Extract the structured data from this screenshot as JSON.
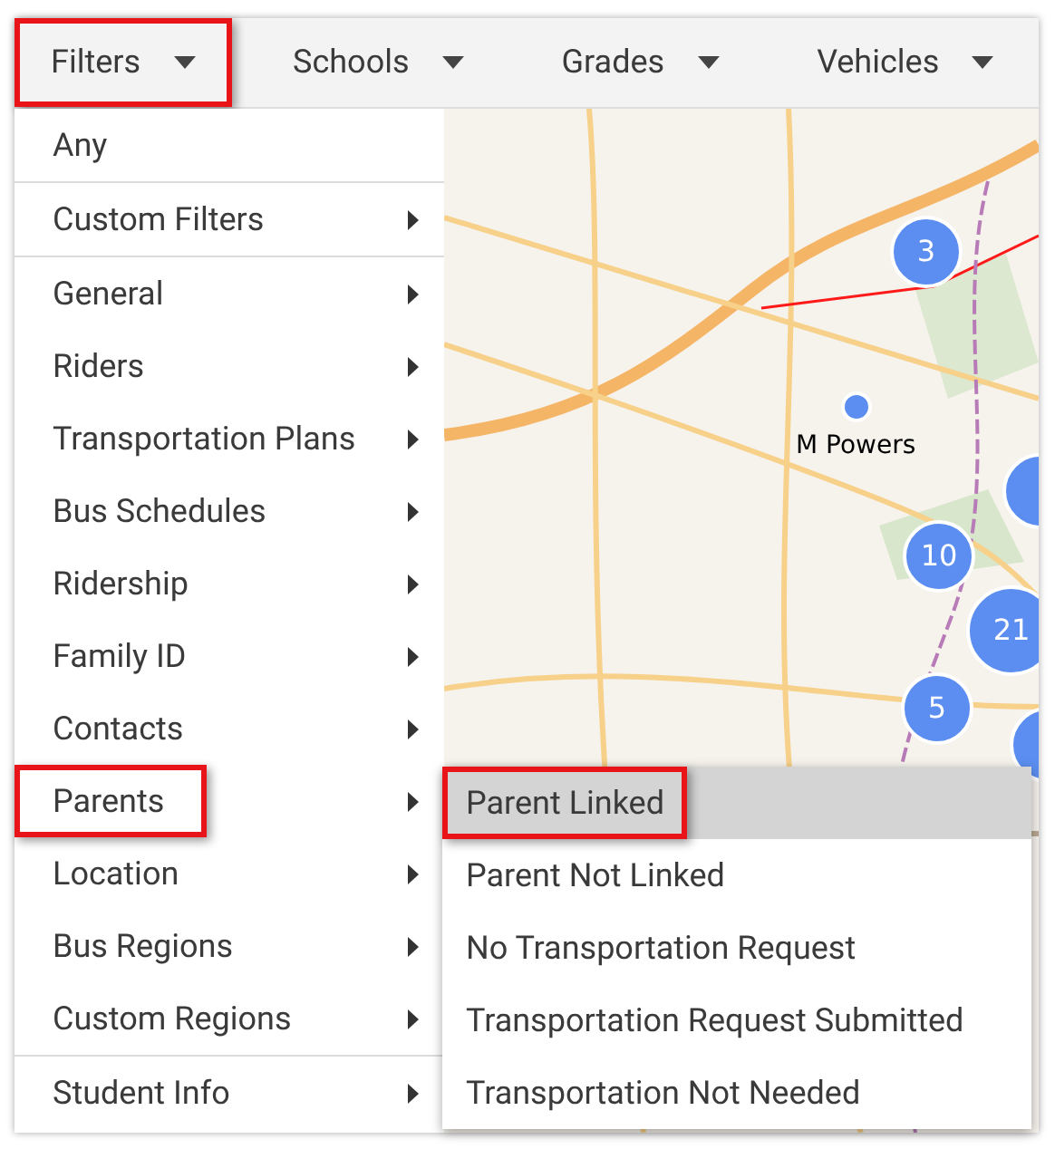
{
  "toolbar": {
    "menus": [
      {
        "label": "Filters",
        "annotated": true
      },
      {
        "label": "Schools",
        "annotated": false
      },
      {
        "label": "Grades",
        "annotated": false
      },
      {
        "label": "Vehicles",
        "annotated": false
      }
    ]
  },
  "filter_menu": {
    "items": [
      {
        "label": "Any",
        "submenu": false,
        "annotated": false,
        "divider_after": true
      },
      {
        "label": "Custom Filters",
        "submenu": true,
        "annotated": false,
        "divider_after": true
      },
      {
        "label": "General",
        "submenu": true,
        "annotated": false,
        "divider_after": false
      },
      {
        "label": "Riders",
        "submenu": true,
        "annotated": false,
        "divider_after": false
      },
      {
        "label": "Transportation Plans",
        "submenu": true,
        "annotated": false,
        "divider_after": false
      },
      {
        "label": "Bus Schedules",
        "submenu": true,
        "annotated": false,
        "divider_after": false
      },
      {
        "label": "Ridership",
        "submenu": true,
        "annotated": false,
        "divider_after": false
      },
      {
        "label": "Family ID",
        "submenu": true,
        "annotated": false,
        "divider_after": false
      },
      {
        "label": "Contacts",
        "submenu": true,
        "annotated": false,
        "divider_after": false
      },
      {
        "label": "Parents",
        "submenu": true,
        "annotated": true,
        "divider_after": false
      },
      {
        "label": "Location",
        "submenu": true,
        "annotated": false,
        "divider_after": false
      },
      {
        "label": "Bus Regions",
        "submenu": true,
        "annotated": false,
        "divider_after": false
      },
      {
        "label": "Custom Regions",
        "submenu": true,
        "annotated": false,
        "divider_after": true
      },
      {
        "label": "Student Info",
        "submenu": true,
        "annotated": false,
        "divider_after": false
      }
    ]
  },
  "parents_submenu": {
    "items": [
      {
        "label": "Parent Linked",
        "selected": true,
        "annotated": true
      },
      {
        "label": "Parent Not Linked",
        "selected": false,
        "annotated": false
      },
      {
        "label": "No Transportation Request",
        "selected": false,
        "annotated": false
      },
      {
        "label": "Transportation Request Submitted",
        "selected": false,
        "annotated": false
      },
      {
        "label": "Transportation Not Needed",
        "selected": false,
        "annotated": false
      }
    ]
  },
  "map": {
    "kind": "picture",
    "school": {
      "label": "M Powers"
    },
    "clusters": [
      {
        "count": "3"
      },
      {
        "count": "10"
      },
      {
        "count": "21"
      },
      {
        "count": "5"
      }
    ]
  }
}
